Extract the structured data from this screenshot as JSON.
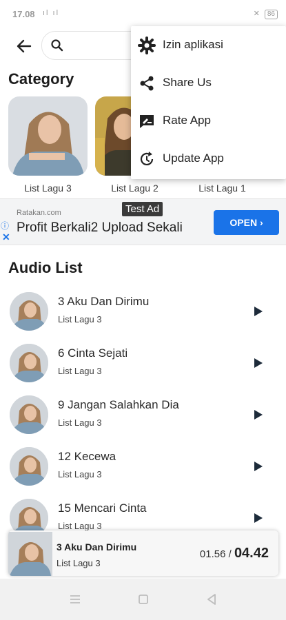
{
  "status_bar": {
    "time": "17.08",
    "signal_text": "ıl ıl",
    "battery": "86"
  },
  "search": {
    "placeholder": ""
  },
  "category": {
    "title": "Category",
    "items": [
      {
        "label": "List Lagu 3"
      },
      {
        "label": "List Lagu 2"
      },
      {
        "label": "List Lagu 1"
      }
    ]
  },
  "ad": {
    "domain": "Ratakan.com",
    "headline": "Profit Berkali2 Upload Sekali",
    "badge": "Test Ad",
    "open_label": "OPEN",
    "info_glyph": "ⓘ",
    "close_glyph": "✕"
  },
  "audio": {
    "title": "Audio List",
    "tracks": [
      {
        "title": "3 Aku Dan Dirimu",
        "subtitle": "List Lagu 3"
      },
      {
        "title": "6 Cinta Sejati",
        "subtitle": "List Lagu 3"
      },
      {
        "title": "9 Jangan Salahkan Dia",
        "subtitle": "List Lagu 3"
      },
      {
        "title": "12 Kecewa",
        "subtitle": "List Lagu 3"
      },
      {
        "title": "15 Mencari Cinta",
        "subtitle": "List Lagu 3"
      }
    ]
  },
  "player": {
    "title": "3 Aku Dan Dirimu",
    "subtitle": "List Lagu 3",
    "current": "01.56 /",
    "total": "04.42"
  },
  "menu": {
    "items": [
      {
        "label": "Izin aplikasi",
        "icon": "gear-icon"
      },
      {
        "label": "Share Us",
        "icon": "share-icon"
      },
      {
        "label": "Rate App",
        "icon": "rate-icon"
      },
      {
        "label": "Update App",
        "icon": "update-icon"
      }
    ]
  },
  "colors": {
    "accent": "#1a73e8",
    "menu_bg": "#ffffff",
    "play_icon": "#1d2b3a"
  }
}
